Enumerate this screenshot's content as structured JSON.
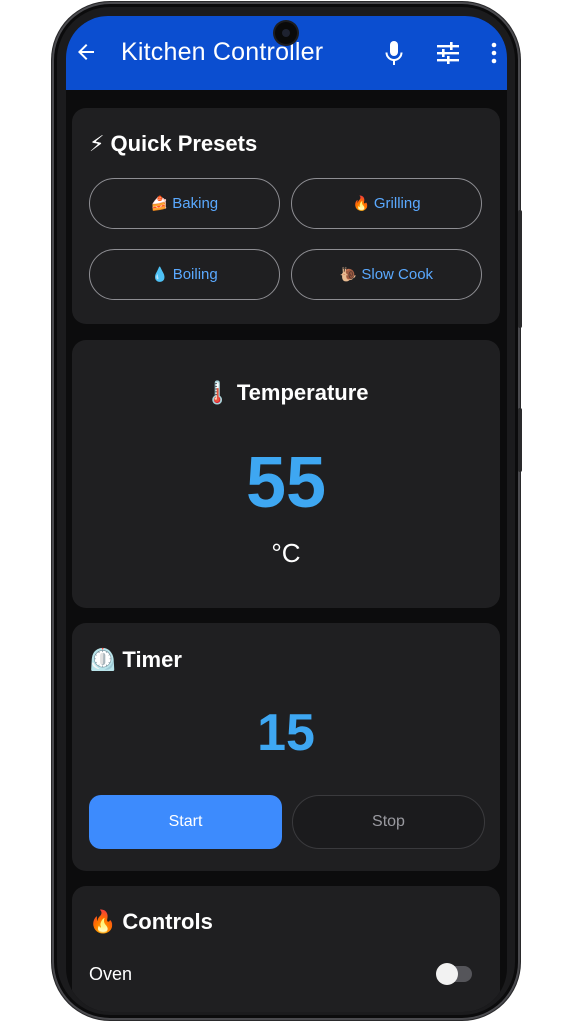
{
  "appbar": {
    "title": "Kitchen Controller",
    "color": "#0b4ed0",
    "icons": [
      "arrow-back-icon",
      "mic-icon",
      "tune-icon",
      "more-vert-icon"
    ]
  },
  "presets": {
    "emoji": "⚡",
    "title": "Quick Presets",
    "items": [
      {
        "emoji": "🍰",
        "label": "Baking"
      },
      {
        "emoji": "🔥",
        "label": "Grilling"
      },
      {
        "emoji": "💧",
        "label": "Boiling"
      },
      {
        "emoji": "🐌",
        "label": "Slow Cook"
      }
    ]
  },
  "temperature": {
    "emoji": "🌡️",
    "title": "Temperature",
    "value": "55",
    "unit": "°C",
    "color": "#3ea7f2"
  },
  "timer": {
    "emoji": "⏲️",
    "title": "Timer",
    "value": "15",
    "start_label": "Start",
    "stop_label": "Stop",
    "start_color": "#3d8bfd"
  },
  "controls": {
    "emoji": "🔥",
    "title": "Controls",
    "items": [
      {
        "label": "Oven",
        "on": false
      }
    ]
  }
}
